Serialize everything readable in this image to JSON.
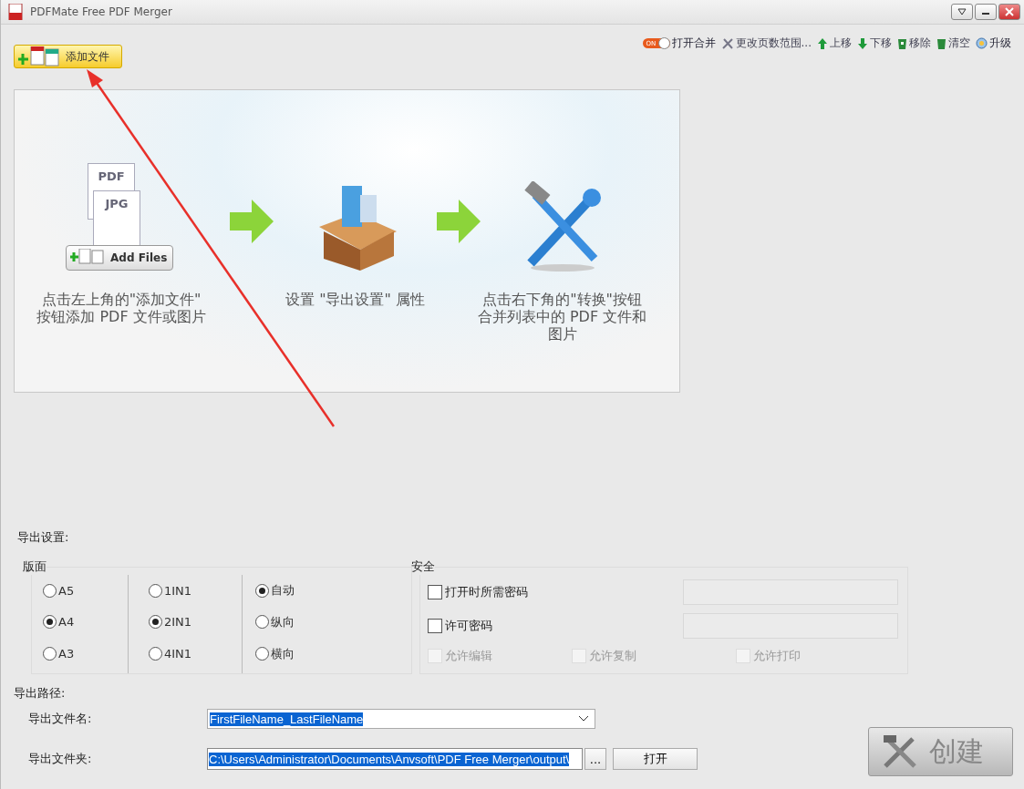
{
  "window": {
    "title": "PDFMate Free PDF Merger"
  },
  "add_button": {
    "label": "添加文件"
  },
  "toolbar": [
    {
      "kind": "toggle",
      "label": "打开合并",
      "toggle_text": "ON",
      "on": true
    },
    {
      "kind": "pages",
      "label": "更改页数范围..."
    },
    {
      "kind": "up",
      "label": "上移"
    },
    {
      "kind": "down",
      "label": "下移"
    },
    {
      "kind": "remove",
      "label": "移除"
    },
    {
      "kind": "clear",
      "label": "清空"
    },
    {
      "kind": "upgrade",
      "label": "升级"
    }
  ],
  "welcome": {
    "steps": [
      {
        "kind": "add",
        "caption": "点击左上角的\"添加文件\" 按钮添加 PDF 文件或图片",
        "doc_labels": [
          "PDF",
          "JPG"
        ],
        "badge": "Add Files"
      },
      {
        "kind": "settings",
        "caption": "设置 \"导出设置\" 属性"
      },
      {
        "kind": "convert",
        "caption": "点击右下角的\"转换\"按钮合并列表中的 PDF 文件和图片"
      }
    ]
  },
  "export_settings": {
    "label": "导出设置:",
    "layout": {
      "title": "版面",
      "columns": [
        [
          {
            "label": "A5",
            "selected": false
          },
          {
            "label": "A4",
            "selected": true
          },
          {
            "label": "A3",
            "selected": false
          }
        ],
        [
          {
            "label": "1IN1",
            "selected": false
          },
          {
            "label": "2IN1",
            "selected": true
          },
          {
            "label": "4IN1",
            "selected": false
          }
        ],
        [
          {
            "label": "自动",
            "selected": true
          },
          {
            "label": "纵向",
            "selected": false
          },
          {
            "label": "横向",
            "selected": false
          }
        ]
      ]
    },
    "security": {
      "title": "安全",
      "passwords": [
        {
          "label": "打开时所需密码",
          "checked": false
        },
        {
          "label": "许可密码",
          "checked": false
        }
      ],
      "permissions": [
        {
          "label": "允许编辑",
          "checked": false,
          "disabled": true
        },
        {
          "label": "允许复制",
          "checked": false,
          "disabled": true
        },
        {
          "label": "允许打印",
          "checked": false,
          "disabled": true
        }
      ]
    }
  },
  "output": {
    "label": "导出路径:",
    "filename_label": "导出文件名:",
    "filename": "FirstFileName_LastFileName",
    "folder_label": "导出文件夹:",
    "folder": "C:\\Users\\Administrator\\Documents\\Anvsoft\\PDF Free Merger\\output\\",
    "browse": "...",
    "open": "打开",
    "create": "创建"
  }
}
